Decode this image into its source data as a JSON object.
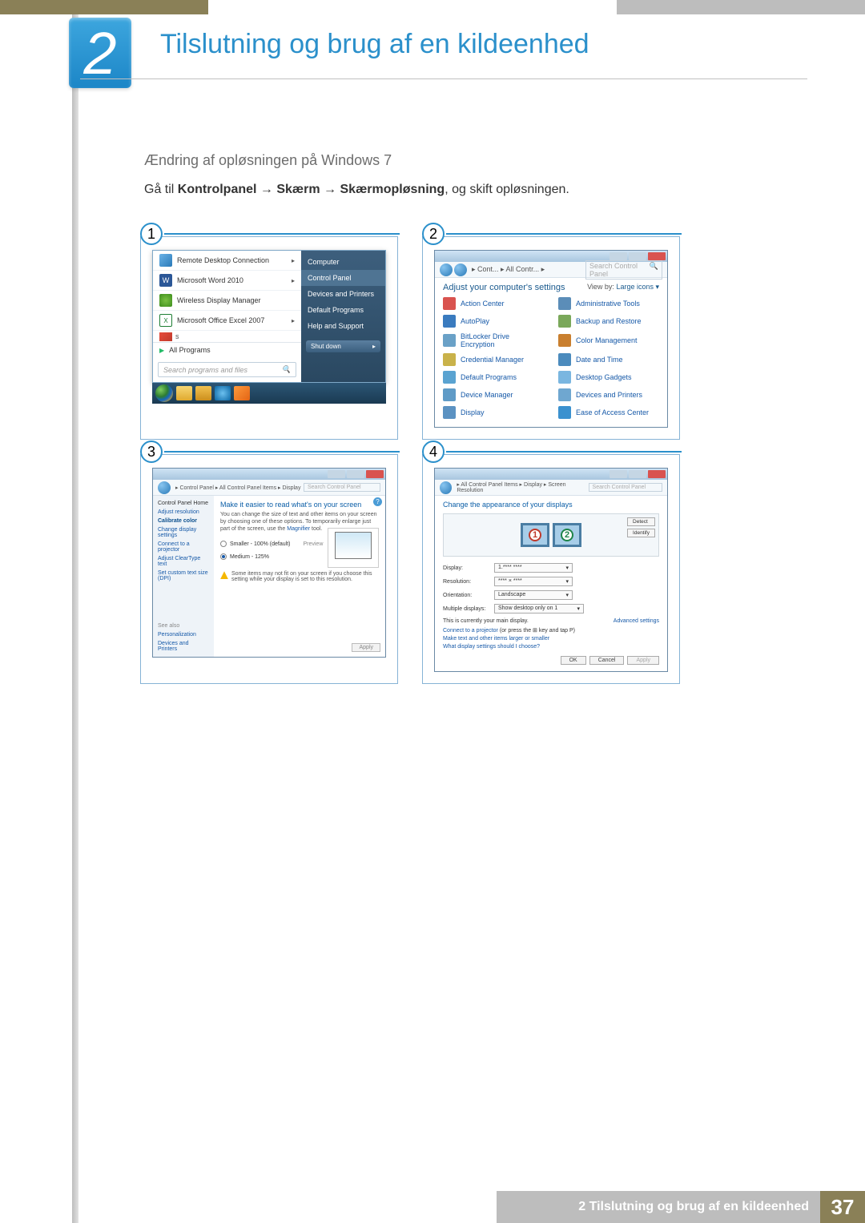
{
  "chapter": {
    "number": "2",
    "title": "Tilslutning og brug af en kildeenhed"
  },
  "subheading": "Ændring af opløsningen på Windows 7",
  "instruction": {
    "prefix": "Gå til ",
    "b1": "Kontrolpanel",
    "arrow": " → ",
    "b2": "Skærm",
    "b3": "Skærmopløsning",
    "suffix": ", og skift opløsningen."
  },
  "shots": {
    "n1": "1",
    "n2": "2",
    "n3": "3",
    "n4": "4"
  },
  "startmenu": {
    "items": [
      {
        "label": "Remote Desktop Connection",
        "sub": true
      },
      {
        "label": "Microsoft Word 2010",
        "sub": true
      },
      {
        "label": "Wireless Display Manager",
        "sub": false
      },
      {
        "label": "Microsoft Office Excel 2007",
        "sub": true
      }
    ],
    "blank_icon_alt": "s",
    "allprograms": "All Programs",
    "search_placeholder": "Search programs and files",
    "right": [
      "Computer",
      "Control Panel",
      "Devices and Printers",
      "Default Programs",
      "Help and Support"
    ],
    "shutdown": "Shut down"
  },
  "controlpanel": {
    "min_alt": "min",
    "max_alt": "max",
    "close_alt": "close",
    "crumb": "▸ Cont... ▸ All Contr... ▸",
    "search_placeholder": "Search Control Panel",
    "heading": "Adjust your computer's settings",
    "viewby_label": "View by:",
    "viewby_value": "Large icons ▾",
    "items": [
      "Action Center",
      "Administrative Tools",
      "AutoPlay",
      "Backup and Restore",
      "BitLocker Drive Encryption",
      "Color Management",
      "Credential Manager",
      "Date and Time",
      "Default Programs",
      "Desktop Gadgets",
      "Device Manager",
      "Devices and Printers",
      "Display",
      "Ease of Access Center"
    ],
    "icon_names": [
      "flag-icon",
      "tools-icon",
      "autoplay-icon",
      "backup-icon",
      "bitlocker-icon",
      "color-icon",
      "safe-icon",
      "clock-icon",
      "defaults-icon",
      "gadgets-icon",
      "devmgr-icon",
      "devices-icon",
      "display-icon",
      "ease-icon"
    ],
    "icon_colors": [
      "#d9534f",
      "#5b8db8",
      "#3a7bbf",
      "#7aa85a",
      "#6aa1c7",
      "#c97f2f",
      "#c9b24a",
      "#4b8bbd",
      "#5aa3d1",
      "#7ab6e0",
      "#5f9bc7",
      "#6fa7d0",
      "#5b92c2",
      "#3b91cf"
    ]
  },
  "dpi": {
    "crumb": "▸ Control Panel ▸ All Control Panel Items ▸ Display",
    "search_placeholder": "Search Control Panel",
    "side": {
      "home": "Control Panel Home",
      "links": [
        "Adjust resolution",
        "Calibrate color",
        "Change display settings",
        "Connect to a projector",
        "Adjust ClearType text",
        "Set custom text size (DPI)"
      ],
      "seealso": "See also",
      "seealso_links": [
        "Personalization",
        "Devices and Printers"
      ]
    },
    "main": {
      "title": "Make it easier to read what's on your screen",
      "desc1": "You can change the size of text and other items on your screen by choosing one of these options. To temporarily enlarge just part of the screen, use the ",
      "desc_link": "Magnifier",
      "desc2": " tool.",
      "radio1": "Smaller - 100% (default)",
      "radio1_note": "Preview",
      "radio2": "Medium - 125%",
      "warn": "Some items may not fit on your screen if you choose this setting while your display is set to this resolution.",
      "apply": "Apply"
    }
  },
  "res": {
    "crumb": "▸ All Control Panel Items ▸ Display ▸ Screen Resolution",
    "search_placeholder": "Search Control Panel",
    "title": "Change the appearance of your displays",
    "detect": "Detect",
    "identify": "Identify",
    "mon1": "1",
    "mon2": "2",
    "fields": {
      "display_lbl": "Display:",
      "display_val": "1.**** ****",
      "resolution_lbl": "Resolution:",
      "resolution_val": "**** × ****",
      "orientation_lbl": "Orientation:",
      "orientation_val": "Landscape",
      "multi_lbl": "Multiple displays:",
      "multi_val": "Show desktop only on 1"
    },
    "main_note": "This is currently your main display.",
    "advanced": "Advanced settings",
    "proj_text": "Connect to a projector",
    "proj_hint": " (or press the ⊞ key and tap P)",
    "link1": "Make text and other items larger or smaller",
    "link2": "What display settings should I choose?",
    "ok": "OK",
    "cancel": "Cancel",
    "apply": "Apply"
  },
  "footer": {
    "label": "2 Tilslutning og brug af en kildeenhed",
    "page": "37"
  }
}
